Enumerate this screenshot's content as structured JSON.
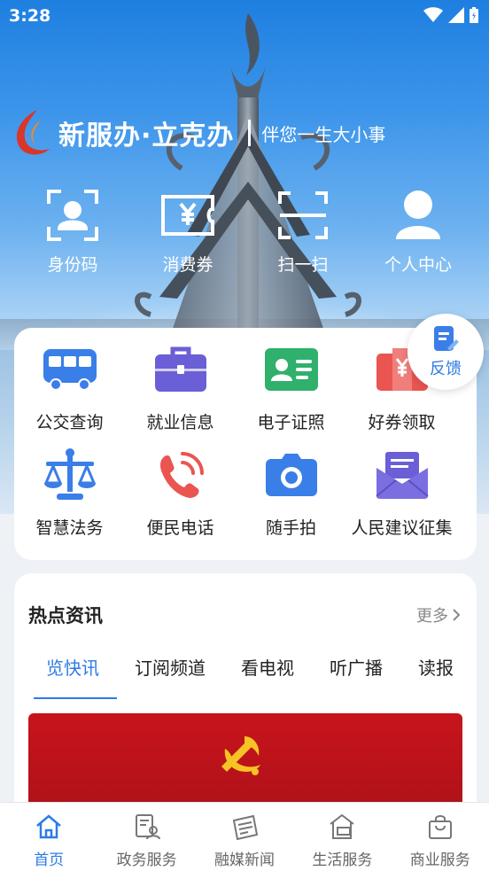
{
  "status_bar": {
    "time": "3:28"
  },
  "brand": {
    "name": "新服办·立克办",
    "slogan": "伴您一生大小事"
  },
  "quick_actions": [
    {
      "label": "身份码",
      "icon": "id-scan-icon"
    },
    {
      "label": "消费券",
      "icon": "coupon-icon"
    },
    {
      "label": "扫一扫",
      "icon": "scan-icon"
    },
    {
      "label": "个人中心",
      "icon": "user-icon"
    }
  ],
  "services": [
    {
      "label": "公交查询",
      "icon": "bus-icon"
    },
    {
      "label": "就业信息",
      "icon": "briefcase-icon"
    },
    {
      "label": "电子证照",
      "icon": "id-card-icon"
    },
    {
      "label": "好券领取",
      "icon": "gift-coupon-icon"
    },
    {
      "label": "智慧法务",
      "icon": "scales-icon"
    },
    {
      "label": "便民电话",
      "icon": "phone-icon"
    },
    {
      "label": "随手拍",
      "icon": "camera-icon"
    },
    {
      "label": "人民建议征集",
      "icon": "mail-icon"
    }
  ],
  "feedback": {
    "label": "反馈"
  },
  "news": {
    "title": "热点资讯",
    "more": "更多",
    "tabs": [
      "览快讯",
      "订阅频道",
      "看电视",
      "听广播",
      "读报"
    ]
  },
  "bottom_nav": [
    {
      "label": "首页",
      "icon": "home-icon"
    },
    {
      "label": "政务服务",
      "icon": "gov-service-icon"
    },
    {
      "label": "融媒新闻",
      "icon": "newspaper-icon"
    },
    {
      "label": "生活服务",
      "icon": "life-service-icon"
    },
    {
      "label": "商业服务",
      "icon": "shopping-bag-icon"
    }
  ],
  "colors": {
    "accent": "#2d7be6",
    "service_blue": "#3a7ee8",
    "service_red": "#ea5552",
    "service_purple": "#6a5fd6",
    "service_green": "#2fb06d"
  }
}
